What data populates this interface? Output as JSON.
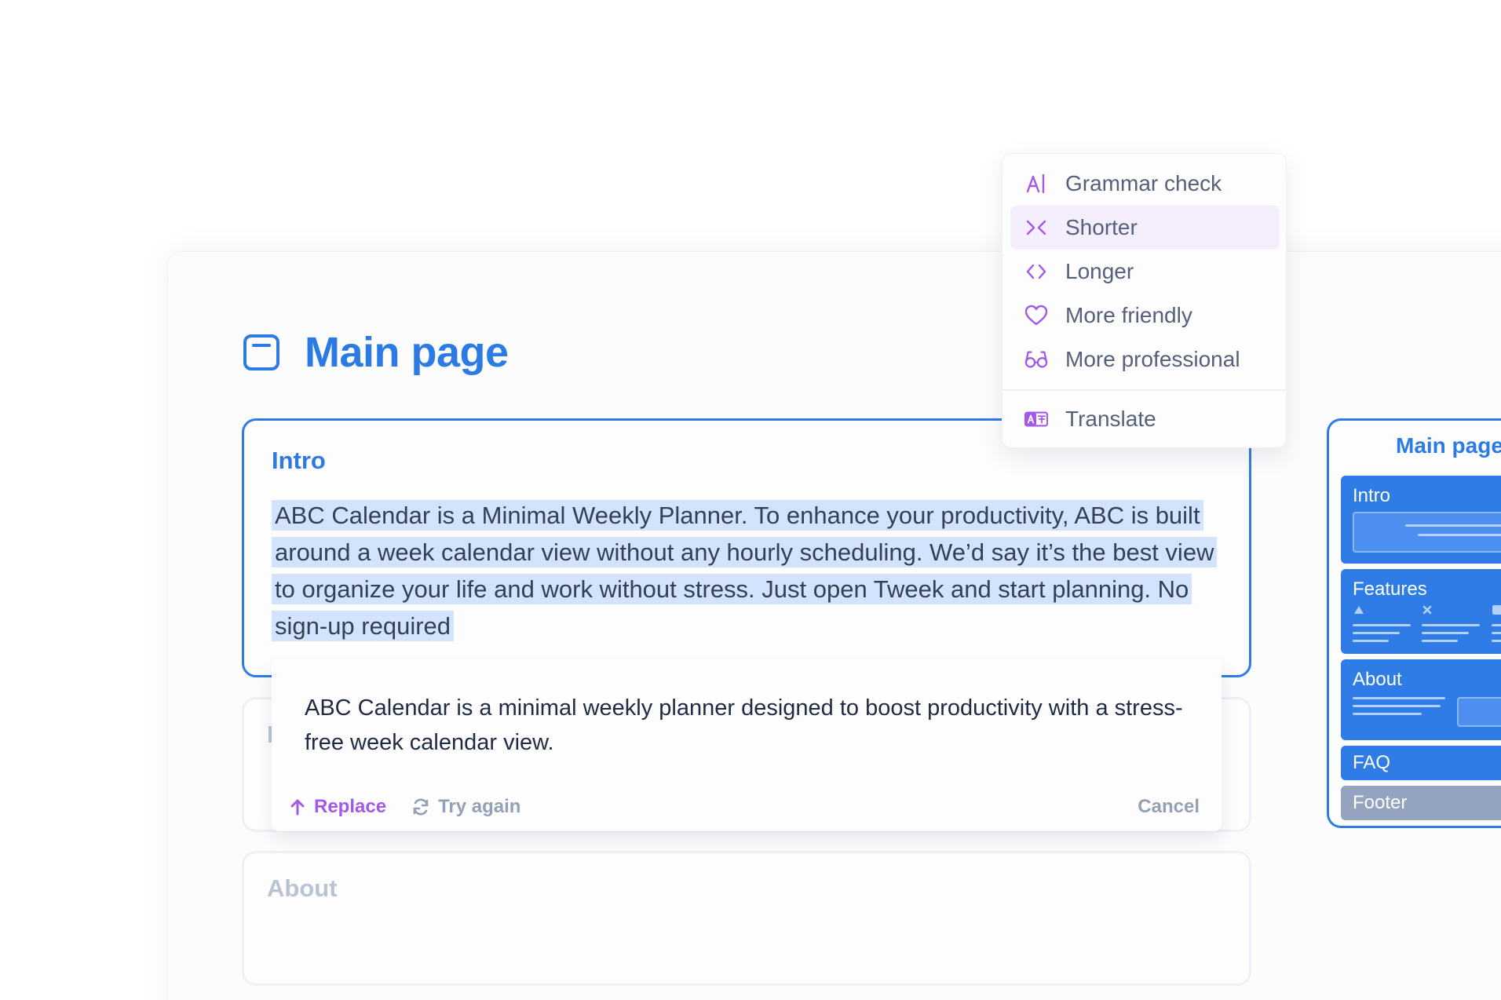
{
  "page": {
    "title": "Main page"
  },
  "sections": {
    "intro": {
      "label": "Intro",
      "text": "ABC Calendar is a Minimal Weekly Planner. To enhance your productivity, ABC is built around a week calendar view without any hourly scheduling. We’d say it’s the best view to organize your life and work without stress. Just open Tweek and start planning. No sign-up required"
    },
    "features": {
      "label": "F"
    },
    "about": {
      "label": "About"
    }
  },
  "suggestion": {
    "text": "ABC Calendar is a minimal weekly planner designed to boost productivity with a stress-free week calendar view.",
    "replace_label": "Replace",
    "try_again_label": "Try again",
    "cancel_label": "Cancel"
  },
  "menu": {
    "items": [
      {
        "label": "Grammar check",
        "icon": "grammar-icon"
      },
      {
        "label": "Shorter",
        "icon": "shorter-icon",
        "active": true
      },
      {
        "label": "Longer",
        "icon": "longer-icon"
      },
      {
        "label": "More friendly",
        "icon": "heart-icon"
      },
      {
        "label": "More professional",
        "icon": "glasses-icon"
      },
      {
        "label": "Translate",
        "icon": "translate-icon"
      }
    ]
  },
  "outline": {
    "title": "Main page",
    "blocks": [
      {
        "label": "Intro"
      },
      {
        "label": "Features"
      },
      {
        "label": "About"
      },
      {
        "label": "FAQ"
      },
      {
        "label": "Footer"
      }
    ]
  },
  "colors": {
    "accent_blue": "#2c7be5",
    "accent_purple": "#a259e6",
    "highlight": "#d4e3fd",
    "muted": "#94a0b6"
  }
}
